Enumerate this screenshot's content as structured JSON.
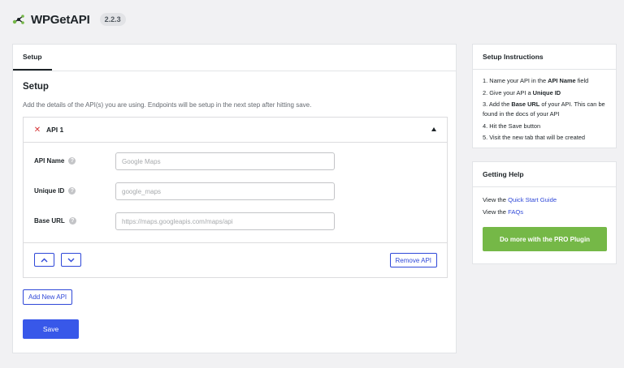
{
  "header": {
    "brand": "WPGetAPI",
    "version": "2.2.3"
  },
  "main": {
    "tab": "Setup",
    "title": "Setup",
    "description": "Add the details of the API(s) you are using. Endpoints will be setup in the next step after hitting save.",
    "api": {
      "title": "API 1",
      "fields": [
        {
          "label": "API Name",
          "placeholder": "Google Maps"
        },
        {
          "label": "Unique ID",
          "placeholder": "google_maps"
        },
        {
          "label": "Base URL",
          "placeholder": "https://maps.googleapis.com/maps/api"
        }
      ],
      "remove_label": "Remove API"
    },
    "add_label": "Add New API",
    "save_label": "Save"
  },
  "instructions": {
    "title": "Setup Instructions",
    "items": [
      {
        "n": "1.",
        "pre": "Name your API in the ",
        "bold": "API Name",
        "post": " field"
      },
      {
        "n": "2.",
        "pre": "Give your API a ",
        "bold": "Unique ID",
        "post": ""
      },
      {
        "n": "3.",
        "pre": "Add the ",
        "bold": "Base URL",
        "post": " of your API. This can be found in the docs of your API"
      },
      {
        "n": "4.",
        "pre": "Hit the Save button",
        "bold": "",
        "post": ""
      },
      {
        "n": "5.",
        "pre": "Visit the new tab that will be created",
        "bold": "",
        "post": ""
      }
    ]
  },
  "help": {
    "title": "Getting Help",
    "line1_prefix": "View the ",
    "line1_link": "Quick Start Guide",
    "line2_prefix": "View the ",
    "line2_link": "FAQs",
    "pro_label": "Do more with the PRO Plugin"
  },
  "colors": {
    "accent": "#3858e9",
    "pro": "#75b847",
    "remove_icon": "#d63638"
  }
}
